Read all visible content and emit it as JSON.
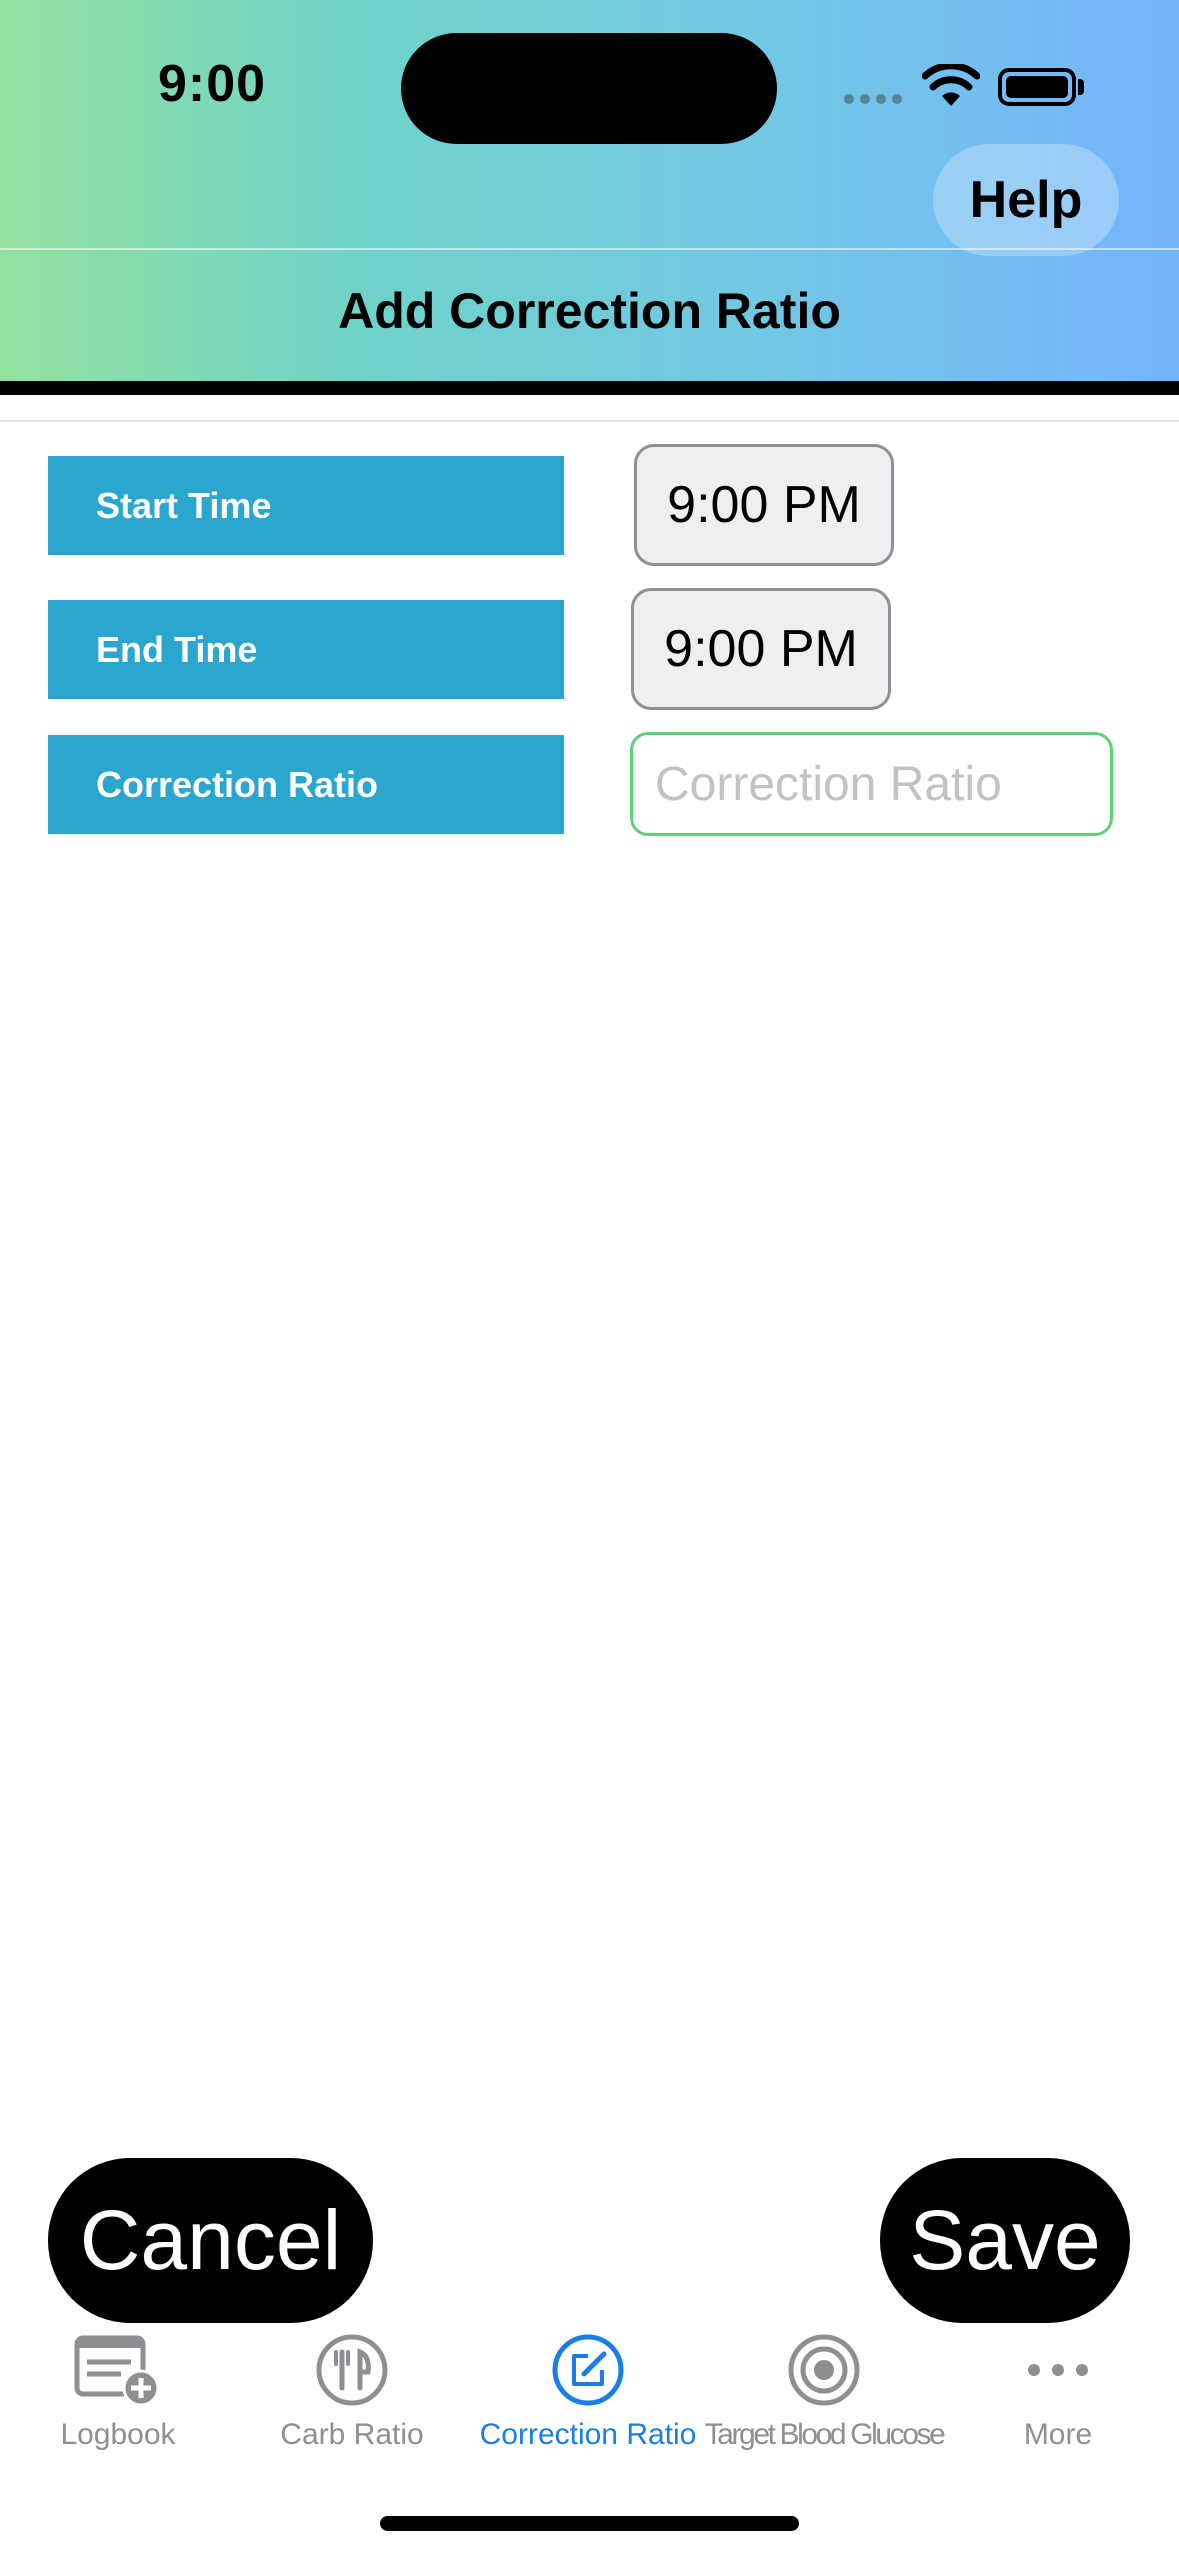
{
  "status_bar": {
    "time": "9:00"
  },
  "nav": {
    "help_label": "Help",
    "title": "Add Correction Ratio"
  },
  "form": {
    "start_time": {
      "label": "Start Time",
      "value": "9:00 PM"
    },
    "end_time": {
      "label": "End Time",
      "value": "9:00 PM"
    },
    "correction_ratio": {
      "label": "Correction Ratio",
      "placeholder": "Correction Ratio",
      "value": ""
    }
  },
  "actions": {
    "cancel_label": "Cancel",
    "save_label": "Save"
  },
  "tabbar": {
    "items": [
      {
        "label": "Logbook",
        "icon": "logbook-add-icon",
        "active": false
      },
      {
        "label": "Carb Ratio",
        "icon": "fork-knife-icon",
        "active": false
      },
      {
        "label": "Correction Ratio",
        "icon": "edit-square-icon",
        "active": true
      },
      {
        "label": "Target Blood Glucose",
        "icon": "target-icon",
        "active": false
      },
      {
        "label": "More",
        "icon": "more-dots-icon",
        "active": false
      }
    ]
  },
  "colors": {
    "label_bg": "#2ba6cf",
    "active_tab": "#1a7ee6",
    "inactive_tab": "#8e8e93",
    "input_border": "#5fd07a"
  }
}
